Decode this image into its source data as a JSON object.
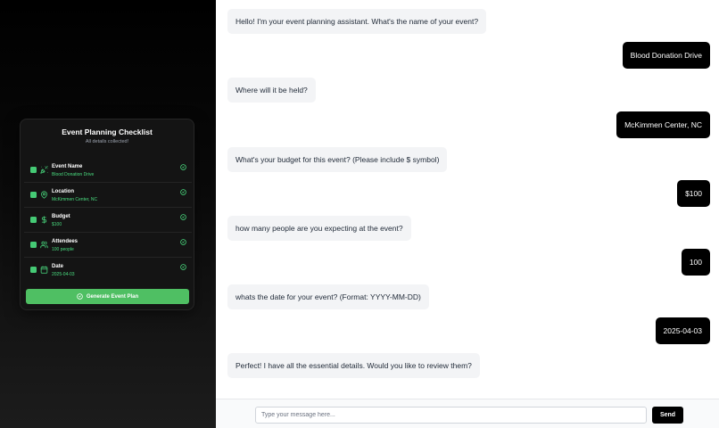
{
  "checklist": {
    "title": "Event Planning Checklist",
    "subtitle": "All details collected!",
    "items": [
      {
        "label": "Event Name",
        "value": "Blood Donation Drive",
        "icon": "party-popper-icon"
      },
      {
        "label": "Location",
        "value": "McKimmen Center, NC",
        "icon": "map-pin-icon"
      },
      {
        "label": "Budget",
        "value": "$100",
        "icon": "dollar-icon"
      },
      {
        "label": "Attendees",
        "value": "100 people",
        "icon": "users-icon"
      },
      {
        "label": "Date",
        "value": "2025-04-03",
        "icon": "calendar-icon"
      }
    ],
    "generate_label": "Generate Event Plan"
  },
  "messages": [
    {
      "role": "bot",
      "text": "Hello! I'm your event planning assistant. What's the name of your event?"
    },
    {
      "role": "user",
      "text": "Blood Donation Drive"
    },
    {
      "role": "bot",
      "text": "Where will it be held?"
    },
    {
      "role": "user",
      "text": "McKimmen Center, NC"
    },
    {
      "role": "bot",
      "text": "What's your budget for this event? (Please include $ symbol)"
    },
    {
      "role": "user",
      "text": "$100"
    },
    {
      "role": "bot",
      "text": "how many people are you expecting at the event?"
    },
    {
      "role": "user",
      "text": "100"
    },
    {
      "role": "bot",
      "text": "whats the date for your event? (Format: YYYY-MM-DD)"
    },
    {
      "role": "user",
      "text": "2025-04-03"
    },
    {
      "role": "bot",
      "text": "Perfect! I have all the essential details. Would you like to review them?"
    }
  ],
  "input": {
    "placeholder": "Type your message here...",
    "value": ""
  },
  "send_label": "Send",
  "colors": {
    "accent_green": "#4ade80",
    "button_green": "#4fbf63",
    "user_bubble": "#000000",
    "bot_bubble": "#f3f4f6"
  }
}
